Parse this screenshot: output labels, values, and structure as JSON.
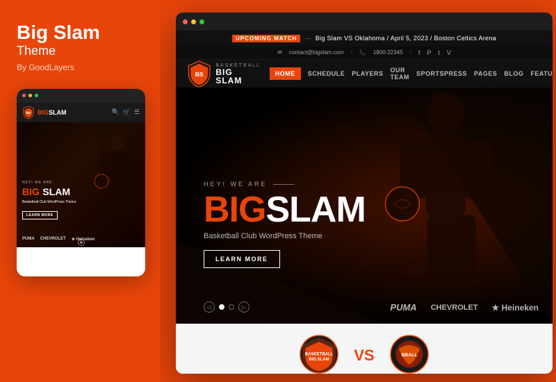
{
  "left": {
    "title_line1": "Big Slam",
    "title_line2": "Theme",
    "by": "By GoodLayers"
  },
  "mobile": {
    "brand_orange": "BIG",
    "brand_white": "SLAM",
    "eyebrow": "HEY! WE ARE",
    "hero_big": "BIG",
    "hero_slam": "SLAM",
    "desc": "Basketball Club WordPress Theme",
    "btn": "LEARN MORE",
    "sponsors": [
      "PUMA",
      "CHEVROLET",
      "★ Heineken"
    ]
  },
  "browser": {
    "announce": {
      "label": "UPCOMING MATCH",
      "text": "Big Slam VS Oklahoma / April 5, 2023 / Boston Celtics Arena"
    },
    "contact": {
      "email": "contact@bigslam.com",
      "phone": "1800-22345",
      "sep": "/"
    },
    "nav": {
      "links": [
        "HOME",
        "SCHEDULE",
        "PLAYERS",
        "OUR TEAM",
        "SPORTSPRESS",
        "PAGES",
        "BLOG",
        "FEATURES"
      ]
    },
    "hero": {
      "eyebrow": "HEY! WE ARE",
      "big": "BIG",
      "slam": "SLAM",
      "desc": "Basketball Club WordPress Theme",
      "btn": "LEARN MORE",
      "sponsors": [
        "PUMA",
        "CHEVROLET",
        "★ Heineken"
      ]
    },
    "bottom": {
      "vs": "VS",
      "team1": "BIG SLAM",
      "team2": "BASKETBALL"
    }
  }
}
